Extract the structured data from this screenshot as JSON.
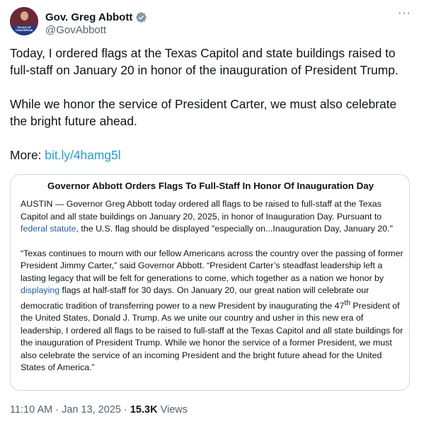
{
  "author": {
    "name": "Gov. Greg Abbott",
    "handle": "@GovAbbott",
    "avatar_text": "TEXAS OF TOMORROW",
    "verified_color": "#829aab"
  },
  "more_label": "···",
  "tweet": {
    "paragraph1": "Today, I ordered flags at the Texas Capitol and state buildings raised to full-staff on January 20 in honor of the inauguration of President Trump.",
    "paragraph2": "While we honor the service of President Carter, we must also celebrate the bright future ahead.",
    "more_prefix": "More: ",
    "link_text": "bit.ly/4hamg5l"
  },
  "card": {
    "title": "Governor Abbott Orders Flags To Full-Staff In Honor Of Inauguration Day",
    "p1_before_link": "AUSTIN — Governor Greg Abbott today ordered all flags to be raised to full-staff at the Texas Capitol and all state buildings on January 20, 2025, in honor of Inauguration Day. Pursuant to ",
    "p1_link": "federal statute",
    "p1_after_link": ", the U.S. flag should be displayed \"especially on...Inauguration Day, January 20.\"",
    "p2_before_link": "“Texas continues to mourn with our fellow Americans across the country over the passing of former President Jimmy Carter,” said Governor Abbott. “President Carter’s steadfast leadership left a lasting legacy that will be felt for generations to come, which together as a nation we honor by ",
    "p2_link": "displaying",
    "p2_after_link": " flags at half-staff for 30 days. On January 20, our great nation will celebrate our democratic tradition of transferring power to a new President by inaugurating the 47",
    "p2_sup": "th",
    "p2_end": " President of the United States, Donald J. Trump. As we unite our country and usher in this new era of leadership, I ordered all flags to be raised to full-staff at the Texas Capitol and all state buildings for the inauguration of President Trump. While we honor the service of a former President, we must also celebrate the service of an incoming President and the bright future ahead for the United States of America.”"
  },
  "footer": {
    "time": "11:10 AM",
    "sep1": " · ",
    "date": "Jan 13, 2025",
    "sep2": " · ",
    "views_count": "15.3K",
    "views_label": " Views"
  },
  "colors": {
    "link": "#1d9bf0",
    "card_link": "#1d5fa8",
    "muted": "#536471",
    "text": "#0f1419"
  }
}
